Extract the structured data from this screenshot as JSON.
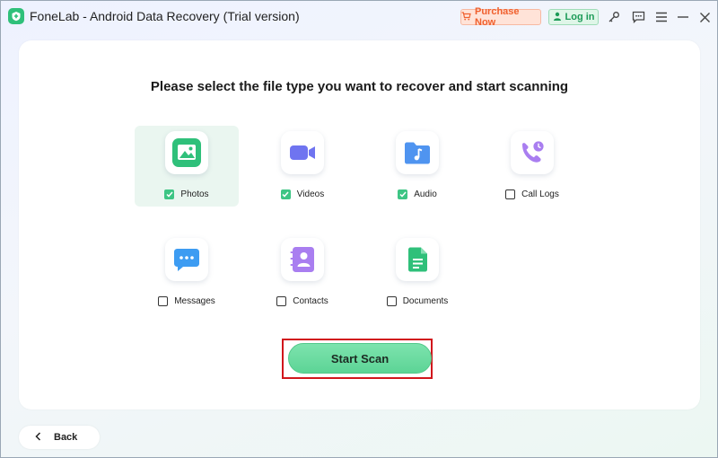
{
  "app": {
    "title": "FoneLab - Android Data Recovery (Trial version)"
  },
  "titlebar": {
    "purchase_label": "Purchase Now",
    "login_label": "Log in",
    "icons": [
      "key-icon",
      "feedback-icon",
      "menu-icon",
      "minimize-icon",
      "close-icon"
    ]
  },
  "main": {
    "heading": "Please select the file type you want to recover and start scanning",
    "file_types": [
      {
        "label": "Photos",
        "checked": true,
        "highlighted": true,
        "icon": "photos-icon",
        "color": "#2fc07a"
      },
      {
        "label": "Videos",
        "checked": true,
        "highlighted": false,
        "icon": "videos-icon",
        "color": "#6f74f0"
      },
      {
        "label": "Audio",
        "checked": true,
        "highlighted": false,
        "icon": "audio-icon",
        "color": "#4f94f0"
      },
      {
        "label": "Call Logs",
        "checked": false,
        "highlighted": false,
        "icon": "call-logs-icon",
        "color": "#a97ef0"
      },
      {
        "label": "Messages",
        "checked": false,
        "highlighted": false,
        "icon": "messages-icon",
        "color": "#3d9cf2"
      },
      {
        "label": "Contacts",
        "checked": false,
        "highlighted": false,
        "icon": "contacts-icon",
        "color": "#a97ef0"
      },
      {
        "label": "Documents",
        "checked": false,
        "highlighted": false,
        "icon": "documents-icon",
        "color": "#2fc07a"
      }
    ],
    "start_scan_label": "Start Scan"
  },
  "footer": {
    "back_label": "Back"
  },
  "colors": {
    "accent": "#3dc584",
    "highlight_border": "#d1161c",
    "purchase": "#f0602e",
    "login": "#1d9b58"
  }
}
